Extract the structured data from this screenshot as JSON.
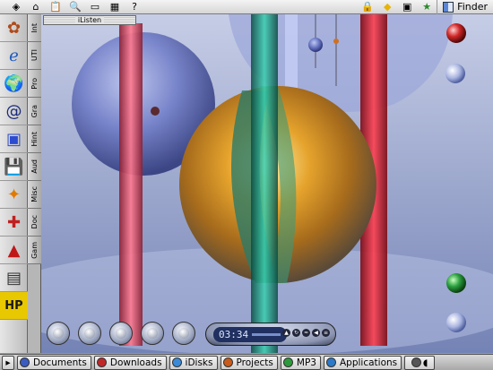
{
  "menubar": {
    "left_icons": [
      "finder-menu-icon",
      "home-icon",
      "clipboard-icon",
      "search-icon",
      "window-icon",
      "calculator-icon",
      "help-icon"
    ],
    "left_glyphs": [
      "◈",
      "⌂",
      "📋",
      "🔍",
      "▭",
      "▦",
      "?"
    ],
    "right_icons": [
      "lock-icon",
      "diamond-icon",
      "contacts-icon",
      "star-icon"
    ],
    "right_glyphs": [
      "🔒",
      "◆",
      "▣",
      "★"
    ],
    "app_name": "Finder"
  },
  "launcher": {
    "buttons": [
      {
        "name": "restaurant-icon",
        "glyph": "✿"
      },
      {
        "name": "internet-explorer-icon",
        "glyph": "ℯ"
      },
      {
        "name": "globe-icon",
        "glyph": "🌍"
      },
      {
        "name": "email-icon",
        "glyph": "@"
      },
      {
        "name": "remote-desktop-icon",
        "glyph": "▣"
      },
      {
        "name": "floppy-disk-icon",
        "glyph": "💾"
      },
      {
        "name": "stick-figure-icon",
        "glyph": "✦"
      },
      {
        "name": "puzzle-icon",
        "glyph": "✚"
      },
      {
        "name": "adobe-icon",
        "glyph": "▲"
      },
      {
        "name": "printer-icon",
        "glyph": "▤"
      },
      {
        "name": "hp-logo-icon",
        "glyph": "HP"
      }
    ],
    "tabs": [
      "Int",
      "UTI",
      "Pro",
      "Gra",
      "Hint",
      "Aud",
      "Misc",
      "Doc",
      "Gam"
    ]
  },
  "ilisten": {
    "title": "iListen"
  },
  "player": {
    "time": "03:34",
    "controls": [
      "previous-button",
      "play-button",
      "pause-button",
      "stop-button",
      "next-button"
    ]
  },
  "taskbar": {
    "items": [
      {
        "name": "documents",
        "label": "Documents",
        "color": "#3a5cc0"
      },
      {
        "name": "downloads",
        "label": "Downloads",
        "color": "#c02828"
      },
      {
        "name": "idisks",
        "label": "iDisks",
        "color": "#3a8ad8"
      },
      {
        "name": "projects",
        "label": "Projects",
        "color": "#c85a1a"
      },
      {
        "name": "mp3",
        "label": "MP3",
        "color": "#2c9a3c"
      },
      {
        "name": "applications",
        "label": "Applications",
        "color": "#2a7ac8"
      }
    ]
  }
}
